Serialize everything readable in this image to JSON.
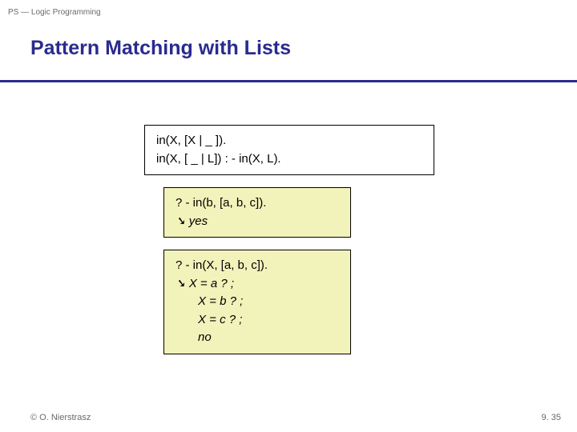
{
  "breadcrumb": "PS — Logic Programming",
  "title": "Pattern Matching with Lists",
  "box1": {
    "line1": "in(X, [X | _ ]).",
    "line2": "in(X, [ _ | L]) : - in(X, L)."
  },
  "box2": {
    "query": "? - in(b, [a, b, c]).",
    "arrow": "➘",
    "result": " yes"
  },
  "box3": {
    "query": "? - in(X, [a, b, c]).",
    "arrow": "➘",
    "r1": " X = a ? ;",
    "r2": "X = b ? ;",
    "r3": "X = c ? ;",
    "r4": "no"
  },
  "footer_left": "© O. Nierstrasz",
  "footer_right": "9. 35"
}
